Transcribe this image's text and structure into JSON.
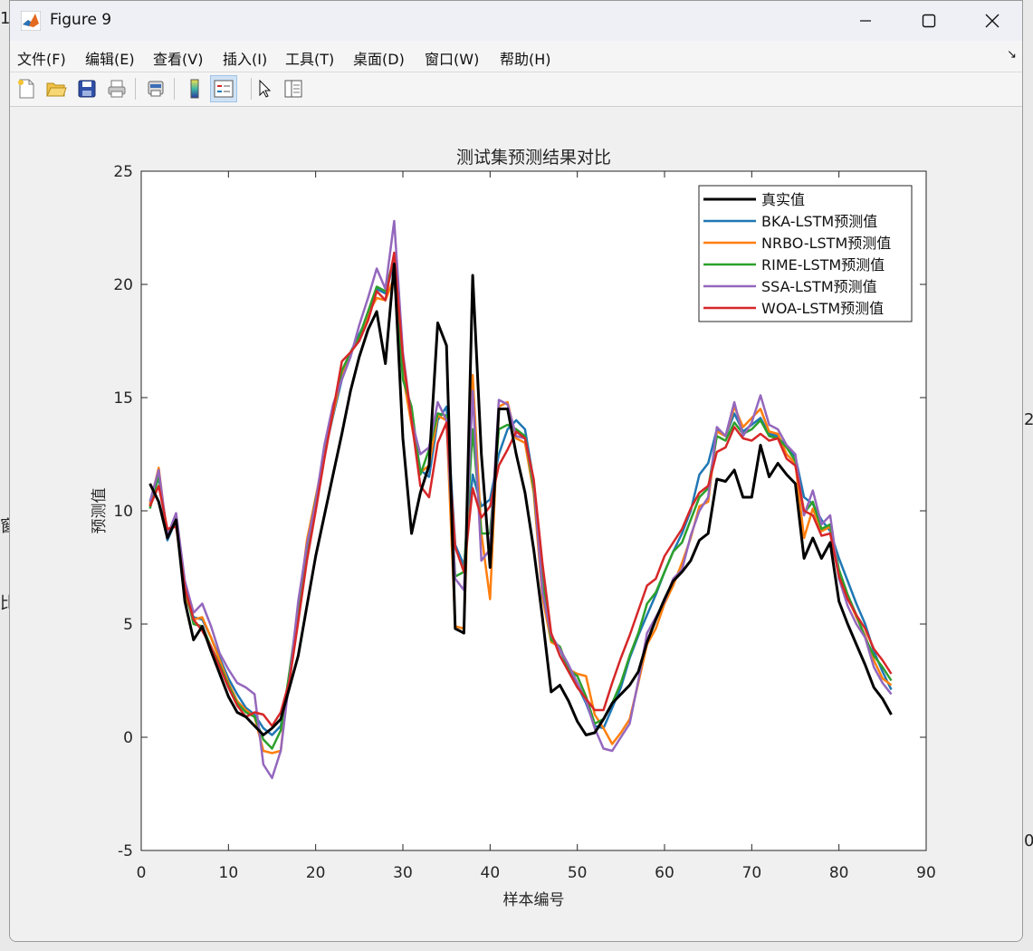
{
  "window": {
    "title": "Figure 9",
    "controls": {
      "minimize": "minimize",
      "maximize": "maximize",
      "close": "close"
    }
  },
  "menu": {
    "items": [
      "文件(F)",
      "编辑(E)",
      "查看(V)",
      "插入(I)",
      "工具(T)",
      "桌面(D)",
      "窗口(W)",
      "帮助(H)"
    ],
    "overflow_icon": "dock-arrow-icon"
  },
  "toolbar": {
    "buttons": [
      "new-figure-icon",
      "open-file-icon",
      "save-icon",
      "print-icon",
      "print-preview-icon",
      "colorbar-icon",
      "legend-icon",
      "pointer-icon",
      "property-editor-icon"
    ],
    "active": "legend-icon"
  },
  "desktop_fragments": [
    "1",
    "窗",
    "比",
    "2",
    "0"
  ],
  "colors": {
    "true": "#000000",
    "bka": "#1f77b4",
    "nrbo": "#ff7f0e",
    "rime": "#2ca02c",
    "ssa": "#9467bd",
    "woa": "#d62728"
  },
  "chart_data": {
    "type": "line",
    "title": "测试集预测结果对比",
    "xlabel": "样本编号",
    "ylabel": "预测值",
    "xlim": [
      0,
      90
    ],
    "ylim": [
      -5,
      25
    ],
    "xticks": [
      0,
      10,
      20,
      30,
      40,
      50,
      60,
      70,
      80,
      90
    ],
    "yticks": [
      -5,
      0,
      5,
      10,
      15,
      20,
      25
    ],
    "legend_position": "top-right",
    "grid": false,
    "x": [
      1,
      2,
      3,
      4,
      5,
      6,
      7,
      8,
      9,
      10,
      11,
      12,
      13,
      14,
      15,
      16,
      17,
      18,
      19,
      20,
      21,
      22,
      23,
      24,
      25,
      26,
      27,
      28,
      29,
      30,
      31,
      32,
      33,
      34,
      35,
      36,
      37,
      38,
      39,
      40,
      41,
      42,
      43,
      44,
      45,
      46,
      47,
      48,
      49,
      50,
      51,
      52,
      53,
      54,
      55,
      56,
      57,
      58,
      59,
      60,
      61,
      62,
      63,
      64,
      65,
      66,
      67,
      68,
      69,
      70,
      71,
      72,
      73,
      74,
      75,
      76,
      77,
      78,
      79,
      80,
      81,
      82,
      83,
      84,
      85,
      86
    ],
    "series": [
      {
        "name": "真实值",
        "color_key": "true",
        "width": 3,
        "values": [
          11.2,
          10.4,
          8.8,
          9.6,
          6.0,
          4.3,
          4.9,
          3.8,
          2.8,
          1.8,
          1.1,
          0.9,
          0.5,
          0.1,
          0.4,
          0.8,
          2.2,
          3.6,
          5.8,
          8.0,
          9.8,
          11.6,
          13.4,
          15.3,
          16.8,
          18.0,
          18.8,
          16.5,
          20.9,
          13.2,
          9.0,
          10.8,
          12.0,
          18.3,
          17.3,
          4.8,
          4.6,
          20.4,
          12.5,
          7.5,
          14.5,
          14.5,
          12.5,
          10.8,
          8.3,
          5.3,
          2.0,
          2.3,
          1.6,
          0.7,
          0.1,
          0.2,
          0.8,
          1.5,
          1.9,
          2.3,
          2.9,
          4.2,
          5.2,
          6.1,
          6.9,
          7.3,
          7.8,
          8.7,
          9.0,
          11.4,
          11.3,
          11.8,
          10.6,
          10.6,
          12.9,
          11.5,
          12.1,
          11.6,
          11.2,
          7.9,
          8.8,
          7.9,
          8.6,
          6.0,
          5.0,
          4.1,
          3.2,
          2.2,
          1.7,
          1.0
        ]
      },
      {
        "name": "BKA-LSTM预测值",
        "color_key": "bka",
        "width": 2.5,
        "values": [
          10.2,
          11.5,
          8.7,
          9.6,
          6.2,
          5.3,
          5.2,
          4.4,
          3.5,
          2.6,
          1.9,
          1.3,
          1.0,
          0.4,
          0.1,
          0.5,
          2.6,
          5.3,
          8.2,
          10.1,
          12.5,
          14.2,
          15.8,
          17.0,
          17.8,
          18.6,
          19.8,
          19.6,
          21.0,
          16.5,
          14.2,
          11.8,
          11.5,
          14.0,
          14.6,
          8.5,
          7.6,
          11.6,
          10.2,
          10.5,
          12.5,
          13.6,
          14.0,
          13.6,
          11.3,
          7.6,
          4.3,
          3.9,
          3.0,
          2.3,
          1.5,
          0.5,
          0.4,
          1.3,
          2.2,
          3.5,
          4.5,
          5.4,
          6.3,
          7.3,
          8.2,
          9.0,
          10.0,
          11.6,
          12.1,
          13.6,
          13.3,
          14.3,
          13.5,
          13.8,
          14.1,
          13.4,
          13.3,
          12.8,
          12.4,
          10.6,
          10.3,
          9.6,
          9.1,
          7.9,
          6.9,
          5.9,
          5.0,
          3.8,
          2.9,
          2.1
        ]
      },
      {
        "name": "NRBO-LSTM预测值",
        "color_key": "nrbo",
        "width": 2.5,
        "values": [
          10.3,
          11.9,
          8.8,
          9.8,
          6.3,
          5.2,
          5.3,
          4.4,
          3.4,
          2.4,
          1.6,
          1.2,
          0.9,
          -0.6,
          -0.7,
          -0.6,
          2.9,
          5.5,
          8.7,
          10.6,
          12.5,
          14.3,
          16.0,
          17.0,
          17.6,
          18.7,
          19.4,
          19.3,
          20.3,
          16.0,
          13.8,
          11.7,
          12.0,
          14.2,
          14.0,
          4.9,
          4.8,
          16.0,
          9.0,
          6.1,
          14.6,
          14.8,
          13.2,
          13.0,
          10.8,
          6.2,
          4.2,
          4.0,
          3.0,
          2.8,
          2.7,
          1.0,
          0.4,
          -0.3,
          0.2,
          0.8,
          2.4,
          4.1,
          4.8,
          5.9,
          6.7,
          7.7,
          8.8,
          10.2,
          10.4,
          13.5,
          13.3,
          14.6,
          13.7,
          14.1,
          14.5,
          13.5,
          13.4,
          12.5,
          12.1,
          8.8,
          10.1,
          9.1,
          9.3,
          7.3,
          6.2,
          5.3,
          4.5,
          3.4,
          2.6,
          2.3
        ]
      },
      {
        "name": "RIME-LSTM预测值",
        "color_key": "rime",
        "width": 2.5,
        "values": [
          10.1,
          11.6,
          9.0,
          9.7,
          6.6,
          5.0,
          4.9,
          4.0,
          3.2,
          2.3,
          1.5,
          1.1,
          0.9,
          -0.1,
          -0.5,
          0.3,
          2.9,
          5.7,
          8.3,
          10.5,
          12.4,
          14.5,
          16.2,
          17.0,
          17.7,
          18.8,
          19.9,
          19.7,
          21.2,
          15.8,
          14.6,
          11.6,
          12.7,
          14.3,
          14.2,
          7.1,
          7.3,
          13.6,
          9.0,
          9.0,
          13.6,
          13.8,
          13.6,
          13.3,
          11.0,
          6.8,
          4.3,
          4.0,
          3.0,
          2.7,
          1.8,
          0.6,
          0.8,
          1.5,
          2.4,
          3.6,
          4.6,
          5.9,
          6.4,
          7.3,
          8.2,
          8.6,
          9.6,
          10.6,
          11.0,
          13.3,
          13.1,
          13.9,
          13.4,
          13.6,
          14.0,
          13.3,
          13.2,
          12.8,
          12.2,
          9.9,
          10.4,
          9.2,
          9.4,
          7.4,
          6.3,
          5.4,
          4.4,
          3.6,
          3.1,
          2.5
        ]
      },
      {
        "name": "SSA-LSTM预测值",
        "color_key": "ssa",
        "width": 2.5,
        "values": [
          10.4,
          11.8,
          8.9,
          9.9,
          6.9,
          5.5,
          5.9,
          4.9,
          3.7,
          3.0,
          2.4,
          2.2,
          1.9,
          -1.2,
          -1.8,
          -0.6,
          2.6,
          6.0,
          8.5,
          10.4,
          12.9,
          14.7,
          15.8,
          16.8,
          18.2,
          19.4,
          20.7,
          19.8,
          22.8,
          17.0,
          14.0,
          12.5,
          12.8,
          14.8,
          14.0,
          7.0,
          6.5,
          15.3,
          7.8,
          8.3,
          14.9,
          14.7,
          13.3,
          13.2,
          11.3,
          6.4,
          4.5,
          3.9,
          3.2,
          2.4,
          1.6,
          0.4,
          -0.5,
          -0.6,
          0.0,
          0.6,
          2.5,
          4.6,
          5.3,
          6.0,
          7.0,
          7.4,
          8.9,
          10.0,
          10.6,
          13.7,
          13.3,
          14.8,
          13.3,
          13.9,
          15.1,
          13.8,
          13.6,
          12.9,
          12.5,
          9.8,
          10.9,
          9.4,
          9.8,
          7.0,
          5.8,
          5.0,
          4.4,
          3.1,
          2.4,
          1.9
        ]
      },
      {
        "name": "WOA-LSTM预测值",
        "color_key": "woa",
        "width": 2.5,
        "values": [
          10.2,
          11.1,
          9.2,
          9.3,
          6.6,
          5.2,
          4.7,
          4.0,
          3.1,
          2.2,
          1.4,
          0.9,
          1.1,
          1.0,
          0.5,
          1.1,
          2.5,
          5.1,
          7.8,
          10.0,
          12.3,
          14.4,
          16.6,
          17.0,
          17.5,
          18.4,
          19.7,
          19.3,
          21.4,
          16.8,
          14.0,
          11.1,
          10.6,
          13.0,
          13.9,
          8.4,
          7.3,
          11.0,
          9.7,
          10.2,
          12.0,
          12.7,
          13.5,
          13.2,
          11.4,
          7.7,
          4.6,
          3.6,
          2.9,
          2.2,
          1.7,
          1.2,
          1.2,
          2.4,
          3.5,
          4.5,
          5.6,
          6.7,
          7.0,
          8.0,
          8.6,
          9.2,
          10.1,
          10.8,
          11.1,
          12.6,
          12.8,
          13.7,
          13.2,
          13.1,
          13.4,
          13.1,
          13.2,
          12.3,
          12.0,
          10.0,
          9.8,
          8.9,
          9.0,
          7.1,
          6.1,
          5.4,
          4.8,
          3.9,
          3.4,
          2.8
        ]
      }
    ]
  }
}
